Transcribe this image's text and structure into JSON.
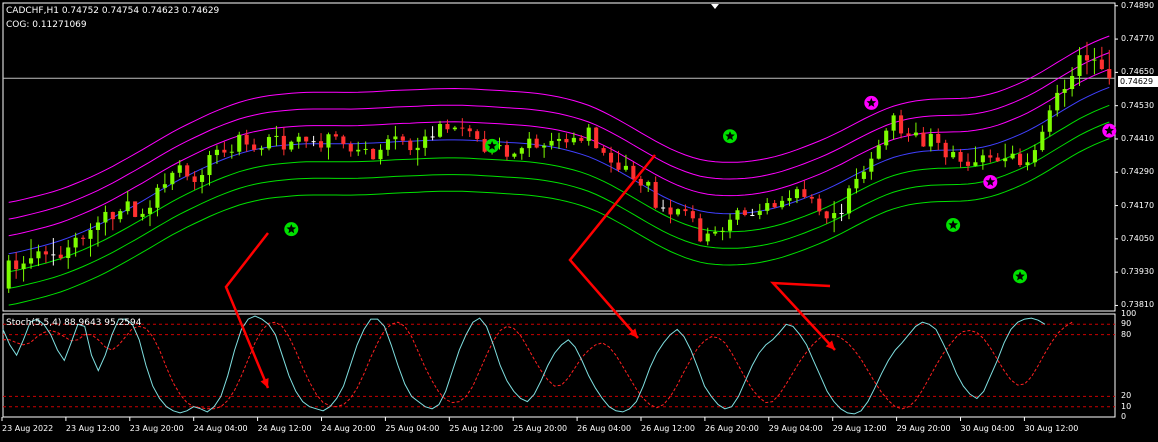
{
  "header": {
    "symbol_info": "CADCHF,H1  0.74752 0.74754 0.74623 0.74629",
    "indicator_info": "COG: 0.11271069",
    "stoch_info": "Stoch(5,5,4) 88.9643 95.2594"
  },
  "price_axis": {
    "labels": [
      "0.74890",
      "0.74770",
      "0.74650",
      "0.74530",
      "0.74410",
      "0.74290",
      "0.74170",
      "0.74050",
      "0.73930",
      "0.73810"
    ],
    "current_price": "0.74629"
  },
  "stoch_axis": {
    "labels": [
      "100",
      "90",
      "80",
      "20",
      "10",
      "0"
    ]
  },
  "time_axis": {
    "labels": [
      "23 Aug 2022",
      "23 Aug 12:00",
      "23 Aug 20:00",
      "24 Aug 04:00",
      "24 Aug 12:00",
      "24 Aug 20:00",
      "25 Aug 04:00",
      "25 Aug 12:00",
      "25 Aug 20:00",
      "26 Aug 04:00",
      "26 Aug 12:00",
      "26 Aug 20:00",
      "29 Aug 04:00",
      "29 Aug 12:00",
      "29 Aug 20:00",
      "30 Aug 04:00",
      "30 Aug 12:00"
    ]
  },
  "colors": {
    "background": "#000000",
    "bull_candle": "#7CFC00",
    "bear_candle": "#FF3030",
    "doji_candle": "#FFFFFF",
    "cog_upper": "#FF00FF",
    "cog_center": "#4040FF",
    "cog_lower": "#00E000",
    "stoch_main": "#7FDFE0",
    "stoch_signal": "#FF2020",
    "arrow": "#FF0000",
    "level_line": "#CC0000"
  },
  "chart_data": {
    "type": "candlestick",
    "symbol": "CADCHF",
    "timeframe": "H1",
    "ylim": [
      0.7379,
      0.749
    ],
    "ohlc": [
      [
        0.73871,
        0.73992,
        0.73855,
        0.73972
      ],
      [
        0.73972,
        0.74002,
        0.73906,
        0.73941
      ],
      [
        0.73941,
        0.73988,
        0.73896,
        0.73961
      ],
      [
        0.73961,
        0.74049,
        0.73942,
        0.7398
      ],
      [
        0.7398,
        0.74029,
        0.73952,
        0.74005
      ],
      [
        0.74005,
        0.74024,
        0.73963,
        0.73994
      ],
      [
        0.73994,
        0.74053,
        0.73954,
        0.73993
      ],
      [
        0.73993,
        0.74024,
        0.73973,
        0.73981
      ],
      [
        0.73981,
        0.74046,
        0.73942,
        0.74019
      ],
      [
        0.74019,
        0.74072,
        0.73986,
        0.74054
      ],
      [
        0.74054,
        0.74063,
        0.74026,
        0.7405
      ],
      [
        0.7405,
        0.74106,
        0.73986,
        0.74082
      ],
      [
        0.74082,
        0.74131,
        0.74022,
        0.74109
      ],
      [
        0.74109,
        0.7417,
        0.74062,
        0.74147
      ],
      [
        0.74147,
        0.74148,
        0.74081,
        0.74121
      ],
      [
        0.74121,
        0.74158,
        0.74109,
        0.7415
      ],
      [
        0.7415,
        0.74223,
        0.74138,
        0.74185
      ],
      [
        0.74185,
        0.74185,
        0.74128,
        0.74129
      ],
      [
        0.74129,
        0.74159,
        0.74116,
        0.7414
      ],
      [
        0.7414,
        0.74189,
        0.74096,
        0.74162
      ],
      [
        0.74162,
        0.74247,
        0.74131,
        0.74234
      ],
      [
        0.74234,
        0.74286,
        0.74217,
        0.74247
      ],
      [
        0.74247,
        0.74294,
        0.74226,
        0.74288
      ],
      [
        0.74288,
        0.74334,
        0.74272,
        0.74315
      ],
      [
        0.74315,
        0.74323,
        0.74261,
        0.74275
      ],
      [
        0.74275,
        0.74294,
        0.74227,
        0.74255
      ],
      [
        0.74255,
        0.74301,
        0.74214,
        0.7428
      ],
      [
        0.7428,
        0.74367,
        0.74242,
        0.74352
      ],
      [
        0.74352,
        0.74387,
        0.7432,
        0.74371
      ],
      [
        0.74371,
        0.744,
        0.74345,
        0.74361
      ],
      [
        0.74361,
        0.7439,
        0.74339,
        0.74364
      ],
      [
        0.74364,
        0.74436,
        0.74351,
        0.74425
      ],
      [
        0.74425,
        0.74443,
        0.74364,
        0.7439
      ],
      [
        0.7439,
        0.74411,
        0.74363,
        0.74371
      ],
      [
        0.74371,
        0.74386,
        0.7435,
        0.74376
      ],
      [
        0.74376,
        0.74427,
        0.74369,
        0.74417
      ],
      [
        0.74417,
        0.74457,
        0.74384,
        0.74421
      ],
      [
        0.74421,
        0.74452,
        0.74351,
        0.74372
      ],
      [
        0.74372,
        0.74404,
        0.74364,
        0.744
      ],
      [
        0.744,
        0.74432,
        0.74375,
        0.74418
      ],
      [
        0.74418,
        0.74419,
        0.74378,
        0.74401
      ],
      [
        0.74401,
        0.74421,
        0.74384,
        0.74402
      ],
      [
        0.74402,
        0.74431,
        0.74364,
        0.74379
      ],
      [
        0.74379,
        0.74433,
        0.74336,
        0.74427
      ],
      [
        0.74427,
        0.74438,
        0.74407,
        0.74419
      ],
      [
        0.74419,
        0.74425,
        0.74376,
        0.74392
      ],
      [
        0.74392,
        0.74401,
        0.74346,
        0.74365
      ],
      [
        0.74365,
        0.744,
        0.74349,
        0.74371
      ],
      [
        0.74371,
        0.74401,
        0.74354,
        0.74374
      ],
      [
        0.74374,
        0.74377,
        0.74335,
        0.74337
      ],
      [
        0.74337,
        0.74391,
        0.74318,
        0.74371
      ],
      [
        0.74371,
        0.74424,
        0.74349,
        0.74409
      ],
      [
        0.74409,
        0.74457,
        0.74372,
        0.74419
      ],
      [
        0.74419,
        0.74428,
        0.74389,
        0.74404
      ],
      [
        0.74404,
        0.74412,
        0.74352,
        0.7437
      ],
      [
        0.7437,
        0.74414,
        0.74314,
        0.74378
      ],
      [
        0.74378,
        0.74444,
        0.74349,
        0.74419
      ],
      [
        0.74419,
        0.74456,
        0.74405,
        0.74418
      ],
      [
        0.74418,
        0.74475,
        0.74414,
        0.74464
      ],
      [
        0.74464,
        0.7448,
        0.74432,
        0.74445
      ],
      [
        0.74445,
        0.74457,
        0.74439,
        0.74451
      ],
      [
        0.74451,
        0.74485,
        0.7442,
        0.74448
      ],
      [
        0.74448,
        0.7446,
        0.74417,
        0.74438
      ],
      [
        0.74438,
        0.74445,
        0.744,
        0.7441
      ],
      [
        0.7441,
        0.74439,
        0.74359,
        0.74364
      ],
      [
        0.74364,
        0.74404,
        0.74354,
        0.74384
      ],
      [
        0.74384,
        0.74415,
        0.74372,
        0.74388
      ],
      [
        0.74388,
        0.74404,
        0.74333,
        0.74346
      ],
      [
        0.74346,
        0.74361,
        0.74339,
        0.74357
      ],
      [
        0.74357,
        0.74382,
        0.74335,
        0.74377
      ],
      [
        0.74377,
        0.74435,
        0.74345,
        0.74411
      ],
      [
        0.74411,
        0.74426,
        0.74376,
        0.74379
      ],
      [
        0.74379,
        0.74395,
        0.74342,
        0.74386
      ],
      [
        0.74386,
        0.74432,
        0.74372,
        0.74403
      ],
      [
        0.74403,
        0.74432,
        0.74374,
        0.7441
      ],
      [
        0.7441,
        0.7443,
        0.74377,
        0.74398
      ],
      [
        0.74398,
        0.74433,
        0.74388,
        0.74414
      ],
      [
        0.74414,
        0.74424,
        0.74396,
        0.74403
      ],
      [
        0.74403,
        0.74464,
        0.74386,
        0.74451
      ],
      [
        0.74451,
        0.74454,
        0.74375,
        0.74377
      ],
      [
        0.74377,
        0.74386,
        0.7435,
        0.7436
      ],
      [
        0.7436,
        0.74382,
        0.74289,
        0.74325
      ],
      [
        0.74325,
        0.74367,
        0.74291,
        0.74299
      ],
      [
        0.74299,
        0.74353,
        0.74292,
        0.74313
      ],
      [
        0.74313,
        0.74327,
        0.74257,
        0.74266
      ],
      [
        0.74266,
        0.74277,
        0.74216,
        0.74242
      ],
      [
        0.74242,
        0.7426,
        0.74219,
        0.74255
      ],
      [
        0.74255,
        0.74275,
        0.74157,
        0.74162
      ],
      [
        0.74162,
        0.74191,
        0.74148,
        0.74163
      ],
      [
        0.74163,
        0.74192,
        0.74106,
        0.74138
      ],
      [
        0.74138,
        0.7416,
        0.74131,
        0.74157
      ],
      [
        0.74157,
        0.74174,
        0.74133,
        0.7415
      ],
      [
        0.7415,
        0.74171,
        0.7411,
        0.74124
      ],
      [
        0.74124,
        0.74141,
        0.74038,
        0.74041
      ],
      [
        0.74041,
        0.7409,
        0.74027,
        0.74069
      ],
      [
        0.74069,
        0.74095,
        0.74061,
        0.74075
      ],
      [
        0.74075,
        0.74092,
        0.74045,
        0.74079
      ],
      [
        0.74079,
        0.74141,
        0.74052,
        0.74119
      ],
      [
        0.74119,
        0.74162,
        0.741,
        0.74153
      ],
      [
        0.74153,
        0.74163,
        0.74131,
        0.74136
      ],
      [
        0.74136,
        0.74158,
        0.74132,
        0.74136
      ],
      [
        0.74136,
        0.74176,
        0.74121,
        0.74151
      ],
      [
        0.74151,
        0.74197,
        0.74138,
        0.74179
      ],
      [
        0.74179,
        0.7419,
        0.7416,
        0.74164
      ],
      [
        0.74164,
        0.74204,
        0.74156,
        0.74187
      ],
      [
        0.74187,
        0.74225,
        0.74168,
        0.74197
      ],
      [
        0.74197,
        0.74238,
        0.74179,
        0.74229
      ],
      [
        0.74229,
        0.7426,
        0.74196,
        0.74201
      ],
      [
        0.74201,
        0.74211,
        0.74178,
        0.74195
      ],
      [
        0.74195,
        0.7421,
        0.74135,
        0.74149
      ],
      [
        0.74149,
        0.74151,
        0.74105,
        0.74124
      ],
      [
        0.74124,
        0.74186,
        0.74074,
        0.74143
      ],
      [
        0.74143,
        0.74176,
        0.74114,
        0.74142
      ],
      [
        0.74142,
        0.74243,
        0.74121,
        0.74232
      ],
      [
        0.74232,
        0.74304,
        0.74214,
        0.74266
      ],
      [
        0.74266,
        0.74313,
        0.74251,
        0.74292
      ],
      [
        0.74292,
        0.74363,
        0.74263,
        0.74339
      ],
      [
        0.74339,
        0.74407,
        0.74336,
        0.74387
      ],
      [
        0.74387,
        0.74449,
        0.74371,
        0.7444
      ],
      [
        0.7444,
        0.74503,
        0.74408,
        0.74495
      ],
      [
        0.74495,
        0.74515,
        0.74412,
        0.7443
      ],
      [
        0.7443,
        0.7445,
        0.744,
        0.74423
      ],
      [
        0.74423,
        0.74469,
        0.74416,
        0.74433
      ],
      [
        0.74433,
        0.74453,
        0.74381,
        0.74383
      ],
      [
        0.74383,
        0.74448,
        0.74365,
        0.74428
      ],
      [
        0.74428,
        0.74448,
        0.7437,
        0.74396
      ],
      [
        0.74396,
        0.74407,
        0.74317,
        0.74344
      ],
      [
        0.74344,
        0.74386,
        0.74338,
        0.74363
      ],
      [
        0.74363,
        0.74374,
        0.74307,
        0.74328
      ],
      [
        0.74328,
        0.74358,
        0.74295,
        0.74313
      ],
      [
        0.74313,
        0.74383,
        0.74311,
        0.74326
      ],
      [
        0.74326,
        0.74372,
        0.74299,
        0.74351
      ],
      [
        0.74351,
        0.74372,
        0.74325,
        0.74343
      ],
      [
        0.74343,
        0.74359,
        0.74327,
        0.7433
      ],
      [
        0.7433,
        0.74393,
        0.74308,
        0.7434
      ],
      [
        0.7434,
        0.74386,
        0.74336,
        0.74357
      ],
      [
        0.74357,
        0.74376,
        0.74309,
        0.74316
      ],
      [
        0.74316,
        0.74358,
        0.74297,
        0.74326
      ],
      [
        0.74326,
        0.7439,
        0.7431,
        0.7437
      ],
      [
        0.7437,
        0.74459,
        0.74364,
        0.74436
      ],
      [
        0.74436,
        0.74532,
        0.74419,
        0.74513
      ],
      [
        0.74513,
        0.74605,
        0.74491,
        0.74576
      ],
      [
        0.74576,
        0.74624,
        0.74526,
        0.7459
      ],
      [
        0.7459,
        0.74669,
        0.74563,
        0.74637
      ],
      [
        0.74637,
        0.74741,
        0.74601,
        0.74712
      ],
      [
        0.74712,
        0.7476,
        0.74643,
        0.74693
      ],
      [
        0.74693,
        0.74738,
        0.74643,
        0.74696
      ],
      [
        0.74696,
        0.74742,
        0.74658,
        0.74662
      ],
      [
        0.74662,
        0.74731,
        0.74606,
        0.74629
      ]
    ],
    "cog_bands": {
      "upper_outer_offset": 0.00185,
      "upper_inner_offset": 0.00125,
      "upper_mid_offset": 0.00065,
      "lower_mid_offset": -0.00065,
      "lower_inner_offset": -0.00125,
      "lower_outer_offset": -0.00185
    },
    "signals": [
      {
        "bar": 38,
        "type": "buy",
        "price": 0.74085
      },
      {
        "bar": 65,
        "type": "buy",
        "price": 0.74385
      },
      {
        "bar": 97,
        "type": "buy",
        "price": 0.7442
      },
      {
        "bar": 116,
        "type": "sell",
        "price": 0.7454
      },
      {
        "bar": 127,
        "type": "buy",
        "price": 0.741
      },
      {
        "bar": 132,
        "type": "sell",
        "price": 0.74255
      },
      {
        "bar": 136,
        "type": "buy",
        "price": 0.73915
      },
      {
        "bar": 148,
        "type": "sell",
        "price": 0.7444
      }
    ],
    "stochastic": {
      "name": "Stoch(5,5,4)",
      "main_last": 88.9643,
      "signal_last": 95.2594,
      "levels": [
        90,
        80,
        20,
        10
      ],
      "ylim": [
        0,
        100
      ],
      "main": [
        85,
        70,
        60,
        75,
        92,
        95,
        90,
        80,
        65,
        55,
        72,
        90,
        88,
        60,
        45,
        60,
        80,
        95,
        95,
        90,
        75,
        50,
        30,
        18,
        10,
        6,
        4,
        6,
        10,
        8,
        5,
        10,
        20,
        40,
        65,
        85,
        95,
        98,
        95,
        90,
        80,
        60,
        40,
        25,
        15,
        10,
        8,
        6,
        10,
        18,
        30,
        50,
        70,
        85,
        95,
        95,
        88,
        70,
        50,
        32,
        20,
        15,
        10,
        8,
        12,
        25,
        45,
        65,
        80,
        92,
        96,
        88,
        70,
        50,
        35,
        25,
        18,
        15,
        22,
        35,
        50,
        62,
        70,
        75,
        68,
        55,
        40,
        28,
        18,
        10,
        6,
        5,
        8,
        15,
        30,
        48,
        62,
        72,
        80,
        85,
        78,
        65,
        48,
        30,
        20,
        12,
        8,
        10,
        20,
        35,
        50,
        62,
        70,
        75,
        82,
        90,
        88,
        80,
        70,
        55,
        40,
        25,
        15,
        8,
        4,
        3,
        6,
        15,
        28,
        42,
        55,
        65,
        72,
        80,
        88,
        92,
        90,
        85,
        72,
        58,
        42,
        30,
        22,
        18,
        25,
        40,
        55,
        72,
        85,
        92,
        95,
        96,
        94,
        90
      ],
      "signal": [
        75,
        75,
        72,
        70,
        72,
        78,
        82,
        84,
        82,
        78,
        74,
        75,
        80,
        80,
        75,
        68,
        65,
        70,
        78,
        86,
        88,
        86,
        78,
        65,
        48,
        33,
        22,
        14,
        10,
        9,
        8,
        8,
        10,
        16,
        26,
        40,
        56,
        72,
        84,
        91,
        92,
        88,
        78,
        64,
        48,
        34,
        22,
        14,
        11,
        10,
        12,
        18,
        28,
        42,
        58,
        72,
        84,
        90,
        92,
        88,
        78,
        63,
        48,
        35,
        24,
        17,
        14,
        15,
        20,
        30,
        45,
        60,
        74,
        84,
        88,
        86,
        79,
        68,
        56,
        45,
        36,
        30,
        31,
        38,
        48,
        58,
        65,
        70,
        72,
        68,
        60,
        49,
        38,
        27,
        18,
        12,
        9,
        12,
        20,
        31,
        44,
        56,
        67,
        74,
        78,
        77,
        72,
        62,
        50,
        38,
        27,
        19,
        14,
        15,
        22,
        32,
        43,
        54,
        63,
        71,
        77,
        80,
        80,
        77,
        72,
        65,
        56,
        45,
        34,
        24,
        16,
        10,
        8,
        10,
        16,
        26,
        38,
        50,
        61,
        70,
        78,
        83,
        84,
        82,
        76,
        67,
        56,
        45,
        36,
        31,
        32,
        39,
        50,
        62,
        73,
        82,
        88,
        92
      ]
    }
  }
}
